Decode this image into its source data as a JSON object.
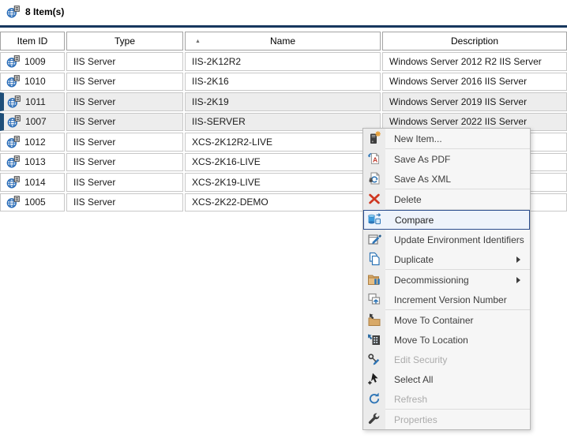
{
  "window": {
    "title": "8 Item(s)",
    "title_icon": "globe-server-icon"
  },
  "table": {
    "columns": [
      {
        "label": "Item ID",
        "sort": null
      },
      {
        "label": "Type",
        "sort": null
      },
      {
        "label": "Name",
        "sort": "asc"
      },
      {
        "label": "Description",
        "sort": null
      }
    ],
    "sort_glyph": "▲",
    "row_icon": "globe-server-icon",
    "rows": [
      {
        "item_id": "1009",
        "type": "IIS Server",
        "name": "IIS-2K12R2",
        "description": "Windows Server 2012 R2 IIS Server",
        "selected": false
      },
      {
        "item_id": "1010",
        "type": "IIS Server",
        "name": "IIS-2K16",
        "description": "Windows Server 2016 IIS Server",
        "selected": false
      },
      {
        "item_id": "1011",
        "type": "IIS Server",
        "name": "IIS-2K19",
        "description": "Windows Server 2019 IIS Server",
        "selected": true
      },
      {
        "item_id": "1007",
        "type": "IIS Server",
        "name": "IIS-SERVER",
        "description": "Windows Server 2022 IIS Server",
        "selected": true
      },
      {
        "item_id": "1012",
        "type": "IIS Server",
        "name": "XCS-2K12R2-LIVE",
        "description": "",
        "selected": false
      },
      {
        "item_id": "1013",
        "type": "IIS Server",
        "name": "XCS-2K16-LIVE",
        "description": "",
        "selected": false
      },
      {
        "item_id": "1014",
        "type": "IIS Server",
        "name": "XCS-2K19-LIVE",
        "description": "",
        "selected": false
      },
      {
        "item_id": "1005",
        "type": "IIS Server",
        "name": "XCS-2K22-DEMO",
        "description": "",
        "selected": false
      }
    ]
  },
  "context_menu": {
    "items": [
      {
        "label": "New Item...",
        "icon": "new-item-icon",
        "enabled": true,
        "highlighted": false,
        "submenu": false,
        "sep_after": true
      },
      {
        "label": "Save As PDF",
        "icon": "save-as-pdf-icon",
        "enabled": true,
        "highlighted": false,
        "submenu": false,
        "sep_after": false
      },
      {
        "label": "Save As XML",
        "icon": "save-as-xml-icon",
        "enabled": true,
        "highlighted": false,
        "submenu": false,
        "sep_after": true
      },
      {
        "label": "Delete",
        "icon": "delete-icon",
        "enabled": true,
        "highlighted": false,
        "submenu": false,
        "sep_after": true
      },
      {
        "label": "Compare",
        "icon": "compare-icon",
        "enabled": true,
        "highlighted": true,
        "submenu": false,
        "sep_after": false
      },
      {
        "label": "Update Environment Identifiers",
        "icon": "update-environment-icon",
        "enabled": true,
        "highlighted": false,
        "submenu": false,
        "sep_after": false
      },
      {
        "label": "Duplicate",
        "icon": "duplicate-icon",
        "enabled": true,
        "highlighted": false,
        "submenu": true,
        "sep_after": true
      },
      {
        "label": "Decommissioning",
        "icon": "decommissioning-icon",
        "enabled": true,
        "highlighted": false,
        "submenu": true,
        "sep_after": false
      },
      {
        "label": "Increment Version Number",
        "icon": "increment-version-icon",
        "enabled": true,
        "highlighted": false,
        "submenu": false,
        "sep_after": true
      },
      {
        "label": "Move To Container",
        "icon": "move-to-container-icon",
        "enabled": true,
        "highlighted": false,
        "submenu": false,
        "sep_after": false
      },
      {
        "label": "Move To Location",
        "icon": "move-to-location-icon",
        "enabled": true,
        "highlighted": false,
        "submenu": false,
        "sep_after": false
      },
      {
        "label": "Edit Security",
        "icon": "edit-security-icon",
        "enabled": false,
        "highlighted": false,
        "submenu": false,
        "sep_after": false
      },
      {
        "label": "Select All",
        "icon": "select-all-icon",
        "enabled": true,
        "highlighted": false,
        "submenu": false,
        "sep_after": false
      },
      {
        "label": "Refresh",
        "icon": "refresh-icon",
        "enabled": false,
        "highlighted": false,
        "submenu": false,
        "sep_after": true
      },
      {
        "label": "Properties",
        "icon": "properties-icon",
        "enabled": false,
        "highlighted": false,
        "submenu": false,
        "sep_after": false
      }
    ]
  },
  "colors": {
    "accent_rule": "#17375e",
    "selection_bar": "#1e4e79",
    "selected_row_bg": "#ededed",
    "menu_highlight_border": "#2b4d8e",
    "menu_highlight_bg": "#eef3fb",
    "icon_blue": "#2e75b6",
    "delete_red": "#cf3721",
    "disabled_text": "#ababab"
  }
}
